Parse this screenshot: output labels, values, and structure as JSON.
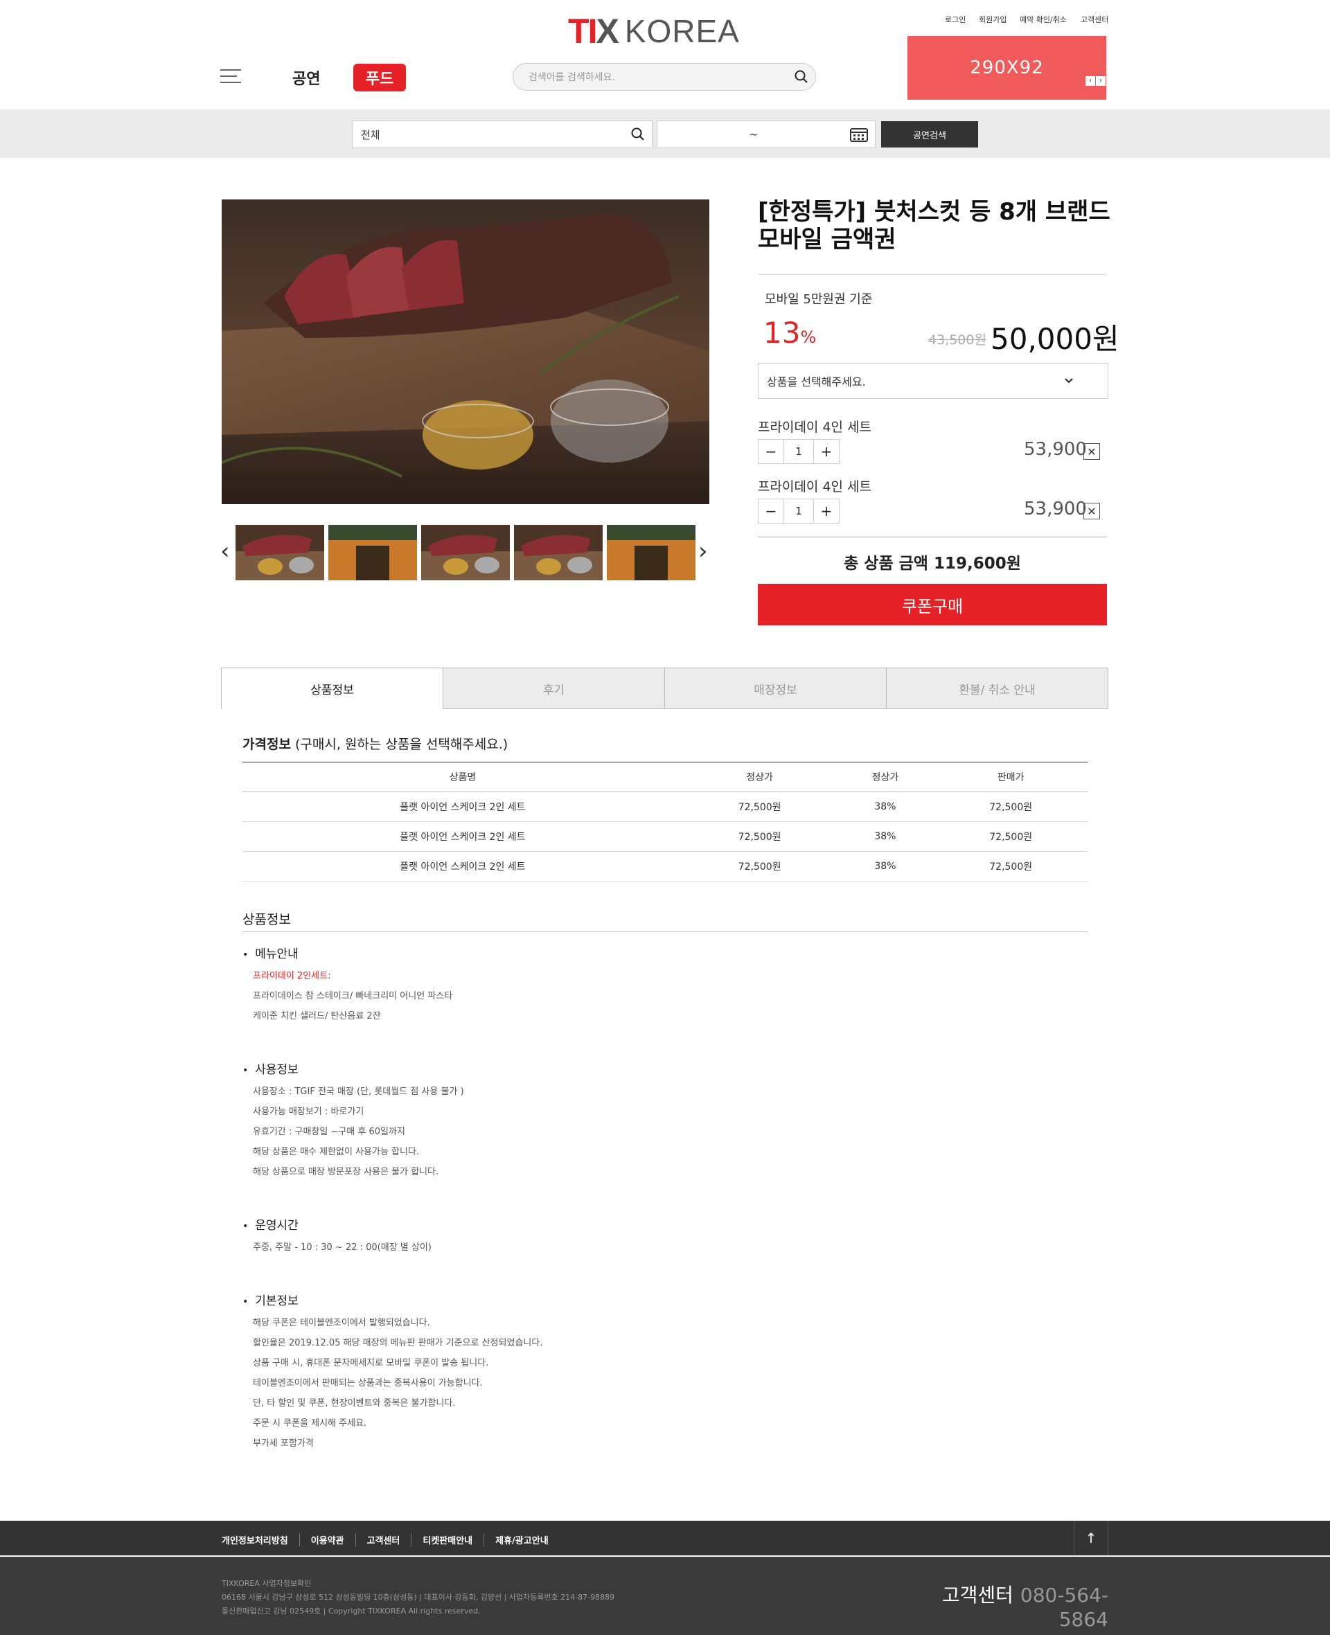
{
  "header": {
    "logo_left": "TIX",
    "logo_right": "KOREA",
    "util_links": [
      "로그인",
      "회원가입",
      "예약 확인/취소",
      "고객센터"
    ],
    "banner_text": "290X92",
    "nav_perf": "공연",
    "nav_food": "푸드",
    "search_placeholder": "검색어를 검색하세요."
  },
  "filter": {
    "category": "전체",
    "date_sep": "~",
    "search_button": "공연검색"
  },
  "product": {
    "title": "[한정특가] 붓처스컷 등 8개 브랜드 모바일 금액권",
    "basis": "모바일 5만원권 기준",
    "discount_num": "13",
    "discount_unit": "%",
    "original_price": "43,500원",
    "price": "50,000원",
    "select_placeholder": "상품을 선택해주세요.",
    "options": [
      {
        "name": "프라이데이 4인 세트",
        "qty": "1",
        "price": "53,900"
      },
      {
        "name": "프라이데이 4인 세트",
        "qty": "1",
        "price": "53,900"
      }
    ],
    "total": "총 상품 금액 119,600원",
    "buy_button": "쿠폰구매"
  },
  "tabs": [
    "상품정보",
    "후기",
    "매장정보",
    "환불/ 취소 안내"
  ],
  "price_info": {
    "title": "가격정보",
    "subtitle": "(구매시, 원하는 상품을 선택해주세요.)",
    "headers": [
      "상품명",
      "정상가",
      "정상가",
      "판매가"
    ],
    "rows": [
      [
        "플랫 아이언 스케이크 2인 세트",
        "72,500원",
        "38%",
        "72,500원"
      ],
      [
        "플랫 아이언 스케이크 2인 세트",
        "72,500원",
        "38%",
        "72,500원"
      ],
      [
        "플랫 아이언 스케이크 2인 세트",
        "72,500원",
        "38%",
        "72,500원"
      ]
    ]
  },
  "product_info": {
    "title": "상품정보",
    "menu_title": "메뉴안내",
    "menu_lines": [
      "프라이데이 2인세트:",
      "프라이데이스 참 스테이크/ 빠네크리미 어니언 파스타",
      "케이준 치킨 샐러드/ 탄산음료 2잔"
    ],
    "usage_title": "사용정보",
    "usage_lines": [
      "사용장소 : TGIF 전국 매장 (단, 롯데월드 점 사용 불가 )",
      "사용가능 매장보기 : 바로가기",
      "유효기간 : 구매창일 ~구매 후 60일까지",
      "해당 상품은 매수 제한없이 사용가능 합니다.",
      "해당 상품으로 매장 방문포장 사용은 불가 합니다."
    ],
    "hours_title": "운영시간",
    "hours_lines": [
      "주중, 주말 - 10 : 30 ~ 22 : 00(매장 별 상이)"
    ],
    "basic_title": "기본정보",
    "basic_lines": [
      "해당 쿠폰은 테이블엔조이에서 발행되었습니다.",
      "할인율은 2019.12.05 해당 매장의 메뉴판 판매가 기준으로 산정되었습니다.",
      "상품 구매 시, 휴대폰 문자메세지로 모바일 쿠폰이 발송 됩니다.",
      "테이블엔조이에서 판매되는 상품과는 중복사용이 가능합니다.",
      "단, 타 할인 및 쿠폰, 현장이벤트와 중복은 불가합니다.",
      "주문 시 쿠폰을 제시해 주세요.",
      "부가세 포함가격"
    ]
  },
  "footer": {
    "links": [
      "개인정보처리방침",
      "이용약관",
      "고객센터",
      "티켓판매안내",
      "제휴/광고안내"
    ],
    "top_button": "↑",
    "company_lines": [
      "TIXKOREA 사업자정보확인",
      "06168 서울시 강남구 삼성로 512 삼성동빌딩 10층(삼성동)   |   대표이사 강동화, 김양선   |   사업자등록번호 214-87-98889",
      "통신판매업신고 강남 02549호   |   Copyright TIXKOREA All rights reserved."
    ],
    "cs_label": "고객센터",
    "cs_phone": "080-564-5864"
  },
  "colors": {
    "accent": "#e62227",
    "banner": "#f05a5b",
    "footer": "#333333"
  }
}
